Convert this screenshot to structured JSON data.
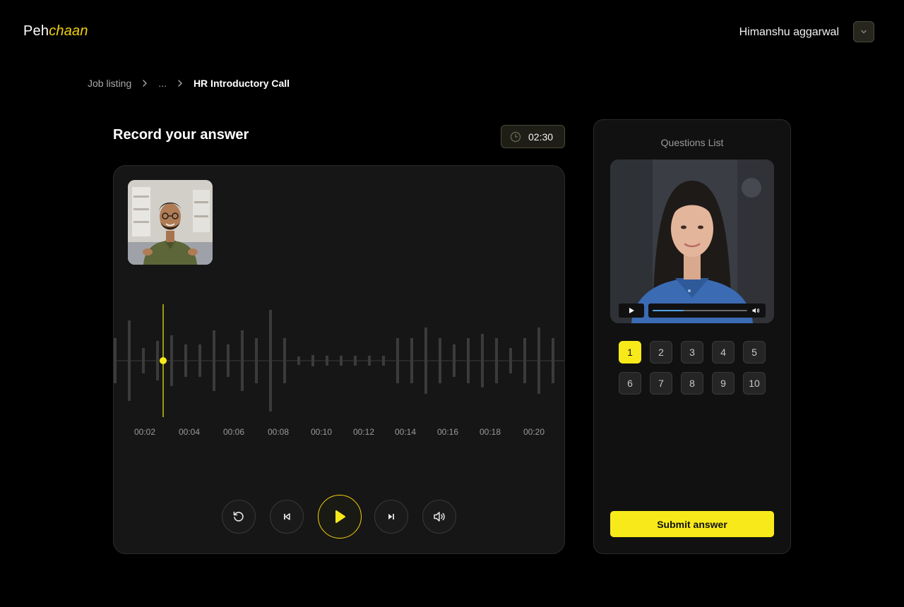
{
  "header": {
    "logo_prefix": "Peh",
    "logo_accent": "chaan",
    "user_name": "Himanshu aggarwal",
    "menu_icon": "chevron-down-icon"
  },
  "breadcrumb": {
    "items": [
      "Job listing",
      "...",
      "HR Introductory Call"
    ]
  },
  "recorder": {
    "title": "Record your answer",
    "timer": "02:30",
    "time_labels": [
      "00:02",
      "00:04",
      "00:06",
      "00:08",
      "00:10",
      "00:12",
      "00:14",
      "00:16",
      "00:18",
      "00:20"
    ],
    "playhead_position": 0.11
  },
  "questions": {
    "title": "Questions List",
    "numbers": [
      "1",
      "2",
      "3",
      "4",
      "5",
      "6",
      "7",
      "8",
      "9",
      "10"
    ],
    "active_index": 0,
    "video_progress": 0.33,
    "submit_label": "Submit answer"
  },
  "colors": {
    "accent": "#f8ea1a",
    "accent_text": "#f5d10a",
    "panel": "#161616",
    "background": "#000000"
  }
}
